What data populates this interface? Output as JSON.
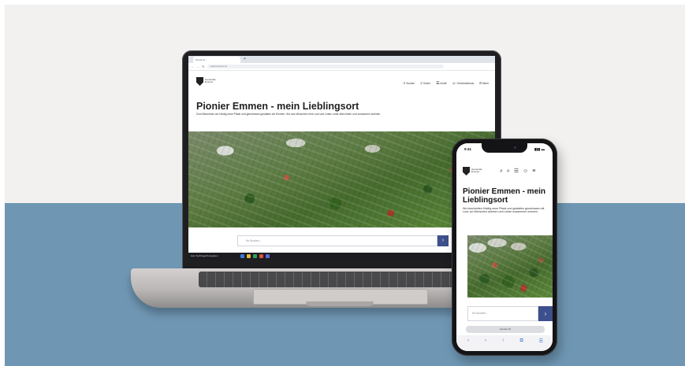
{
  "laptop": {
    "browser": {
      "tab_title": "Pionier E...",
      "tab_plus": "+",
      "nav_arrows": "← → ↻",
      "address": "www.emmen.ch"
    },
    "site": {
      "logo_text": "Gemeinde Emmen",
      "nav": [
        {
          "icon": "search-icon",
          "glyph": "⌕",
          "label": "Suchen"
        },
        {
          "icon": "search-icon",
          "glyph": "⌕",
          "label": "Suche"
        },
        {
          "icon": "document-icon",
          "glyph": "☰",
          "label": "Inhalt"
        },
        {
          "icon": "person-icon",
          "glyph": "☺",
          "label": "Gemeindehaus"
        },
        {
          "icon": "menu-icon",
          "glyph": "≡",
          "label": "Menü"
        }
      ],
      "title": "Pionier Emmen - mein Lieblingsort",
      "subtitle": "Zum Bewohnen wo Huldig neue Pfade und gemeinsam gestalten wir Emmen. Wo aus Menschen eine Lust und Leben unter alles leben und zusammen wohnen.",
      "search_placeholder": "Ihr Suchen...",
      "search_button": "›"
    },
    "taskbar_text": "Hier Suchbegriff eingeben"
  },
  "phone": {
    "status": {
      "time": "9:41",
      "signal": "▮▮▮ ▬"
    },
    "logo_text": "Gemeinde Emmen",
    "icons": [
      {
        "icon": "search-icon",
        "glyph": "⌕"
      },
      {
        "icon": "magnifier-icon",
        "glyph": "⌕"
      },
      {
        "icon": "document-icon",
        "glyph": "☰"
      },
      {
        "icon": "person-icon",
        "glyph": "☺"
      },
      {
        "icon": "menu-icon",
        "glyph": "≡"
      }
    ],
    "title": "Pionier Emmen - mein Lieblingsort",
    "subtitle": "Wo beschreiten Huldig neue Pfade und gestalten gemeinsam mit Lust, wo Menschen wohnen und Leben zusammen wohnen.",
    "search_placeholder": "Ihr Suchbe...",
    "search_button": "›",
    "url": "emmen.ch",
    "bottom_icons": [
      "‹",
      "›",
      "↑",
      "⧉",
      "☰"
    ]
  },
  "colors": {
    "background_top": "#f2f1ef",
    "background_bottom": "#6f97b4",
    "accent": "#3d4f8c"
  }
}
